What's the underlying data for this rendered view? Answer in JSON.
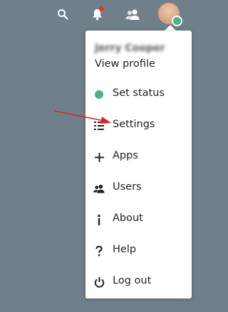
{
  "topbar": {
    "icons": [
      "search-icon",
      "bell-icon",
      "contacts-icon"
    ],
    "notification_dot_color": "#e9322d",
    "status_color": "#49b382"
  },
  "menu": {
    "user_name": "Jerry Cooper",
    "view_profile": "View profile",
    "items": [
      {
        "icon": "status-dot-icon",
        "label": "Set status"
      },
      {
        "icon": "settings-list-icon",
        "label": "Settings"
      },
      {
        "icon": "plus-icon",
        "label": "Apps"
      },
      {
        "icon": "users-icon",
        "label": "Users"
      },
      {
        "icon": "info-icon",
        "label": "About"
      },
      {
        "icon": "help-icon",
        "label": "Help"
      },
      {
        "icon": "power-icon",
        "label": "Log out"
      }
    ]
  },
  "annotation": {
    "arrow_color": "#e0202a",
    "points_to": "Settings"
  },
  "colors": {
    "background": "#6f808a",
    "menu_background": "#ffffff",
    "text": "#222222"
  }
}
